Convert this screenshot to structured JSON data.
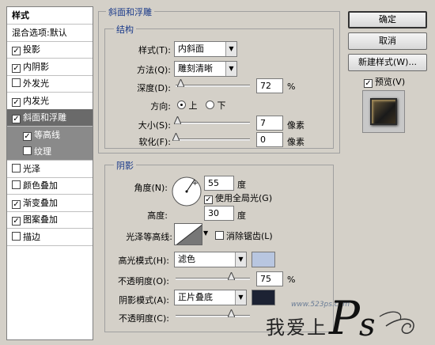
{
  "left_panel": {
    "items": [
      {
        "label": "样式",
        "checkbox": null,
        "style": "bold"
      },
      {
        "label": "混合选项:默认",
        "checkbox": null,
        "style": "normal"
      },
      {
        "label": "投影",
        "checkbox": true
      },
      {
        "label": "内阴影",
        "checkbox": true
      },
      {
        "label": "外发光",
        "checkbox": false
      },
      {
        "label": "内发光",
        "checkbox": true
      },
      {
        "label": "斜面和浮雕",
        "checkbox": true,
        "style": "selected"
      },
      {
        "label": "等高线",
        "checkbox": true,
        "style": "sub"
      },
      {
        "label": "纹理",
        "checkbox": false,
        "style": "sub"
      },
      {
        "label": "光泽",
        "checkbox": false
      },
      {
        "label": "颜色叠加",
        "checkbox": false
      },
      {
        "label": "渐变叠加",
        "checkbox": true
      },
      {
        "label": "图案叠加",
        "checkbox": true
      },
      {
        "label": "描边",
        "checkbox": false
      }
    ]
  },
  "bevel": {
    "section_title": "斜面和浮雕",
    "structure_title": "结构",
    "style_label": "样式(T):",
    "style_value": "内斜面",
    "method_label": "方法(Q):",
    "method_value": "雕刻清晰",
    "depth_label": "深度(D):",
    "depth_value": "72",
    "depth_unit": "%",
    "depth_fraction": 0.07,
    "direction_label": "方向:",
    "direction_up": "上",
    "direction_down": "下",
    "direction_selected": "上",
    "size_label": "大小(S):",
    "size_value": "7",
    "size_unit": "像素",
    "size_fraction": 0.03,
    "soften_label": "软化(F):",
    "soften_value": "0",
    "soften_unit": "像素",
    "soften_fraction": 0.0
  },
  "shading": {
    "title": "阴影",
    "angle_label": "角度(N):",
    "angle_value": "55",
    "angle_unit": "度",
    "global_light_label": "使用全局光(G)",
    "global_light_checked": true,
    "altitude_label": "高度:",
    "altitude_value": "30",
    "altitude_unit": "度",
    "gloss_contour_label": "光泽等高线:",
    "anti_alias_label": "消除锯齿(L)",
    "anti_alias_checked": false,
    "highlight_mode_label": "高光模式(H):",
    "highlight_mode_value": "滤色",
    "highlight_color": "#b8c6e0",
    "highlight_opacity_label": "不透明度(O):",
    "highlight_opacity_value": "75",
    "highlight_opacity_unit": "%",
    "highlight_opacity_fraction": 0.75,
    "shadow_mode_label": "阴影模式(A):",
    "shadow_mode_value": "正片叠底",
    "shadow_color": "#1c2233",
    "shadow_opacity_label": "不透明度(C):",
    "shadow_opacity_fraction": 0.75
  },
  "buttons": {
    "ok": "确定",
    "cancel": "取消",
    "new_style": "新建样式(W)...",
    "preview_label": "预览(V)",
    "preview_checked": true
  },
  "watermark": {
    "url": "www.523ps.com",
    "text": "我爱上",
    "logo_letters": "PS"
  }
}
